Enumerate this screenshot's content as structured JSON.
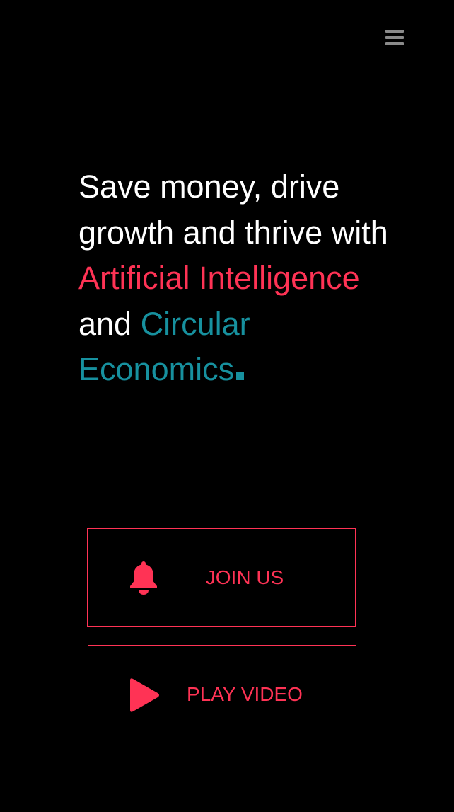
{
  "header": {
    "menu_icon": "hamburger-menu-icon",
    "menu_color": "#8a8a8a"
  },
  "hero": {
    "line_part_1": "Save money, drive growth and thrive with",
    "highlight_1": "Artificial Intelligence",
    "connector": "and",
    "highlight_2": "Circular Economics",
    "colors": {
      "text": "#ffffff",
      "highlight_1": "#ff3355",
      "highlight_2": "#17919f"
    }
  },
  "actions": {
    "join": {
      "label": "JOIN US",
      "icon": "bell-icon"
    },
    "play": {
      "label": "PLAY VIDEO",
      "icon": "play-icon"
    },
    "accent": "#ff3355"
  },
  "background": "#000000"
}
